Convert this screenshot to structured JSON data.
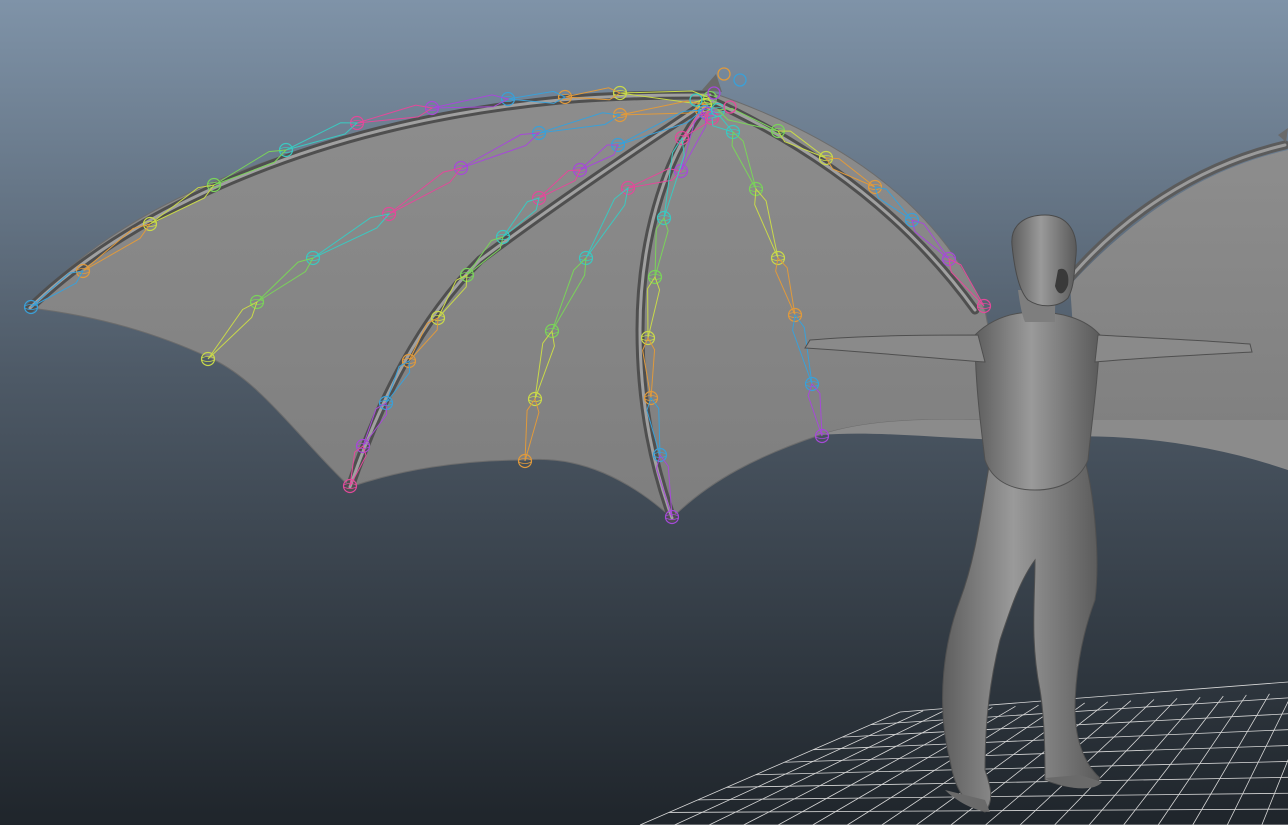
{
  "viewport": {
    "panel": "perspective-view",
    "background_top": "#7f93a8",
    "background_mid": "#4e5a67",
    "background_bottom": "#1f252b"
  },
  "scene": {
    "mesh_color": "#8a8a8a",
    "membrane_color": "#8f8f8f",
    "grid_color": "#d8d8d8",
    "joint_colors": [
      "#7ad35a",
      "#c9d94a",
      "#e09a3c",
      "#3aa0d8",
      "#a64ad8",
      "#e24a9a",
      "#3cc8c0"
    ],
    "objects": [
      "character-body",
      "left-wing",
      "right-wing",
      "wing-skeleton-joints",
      "ground-grid"
    ]
  }
}
